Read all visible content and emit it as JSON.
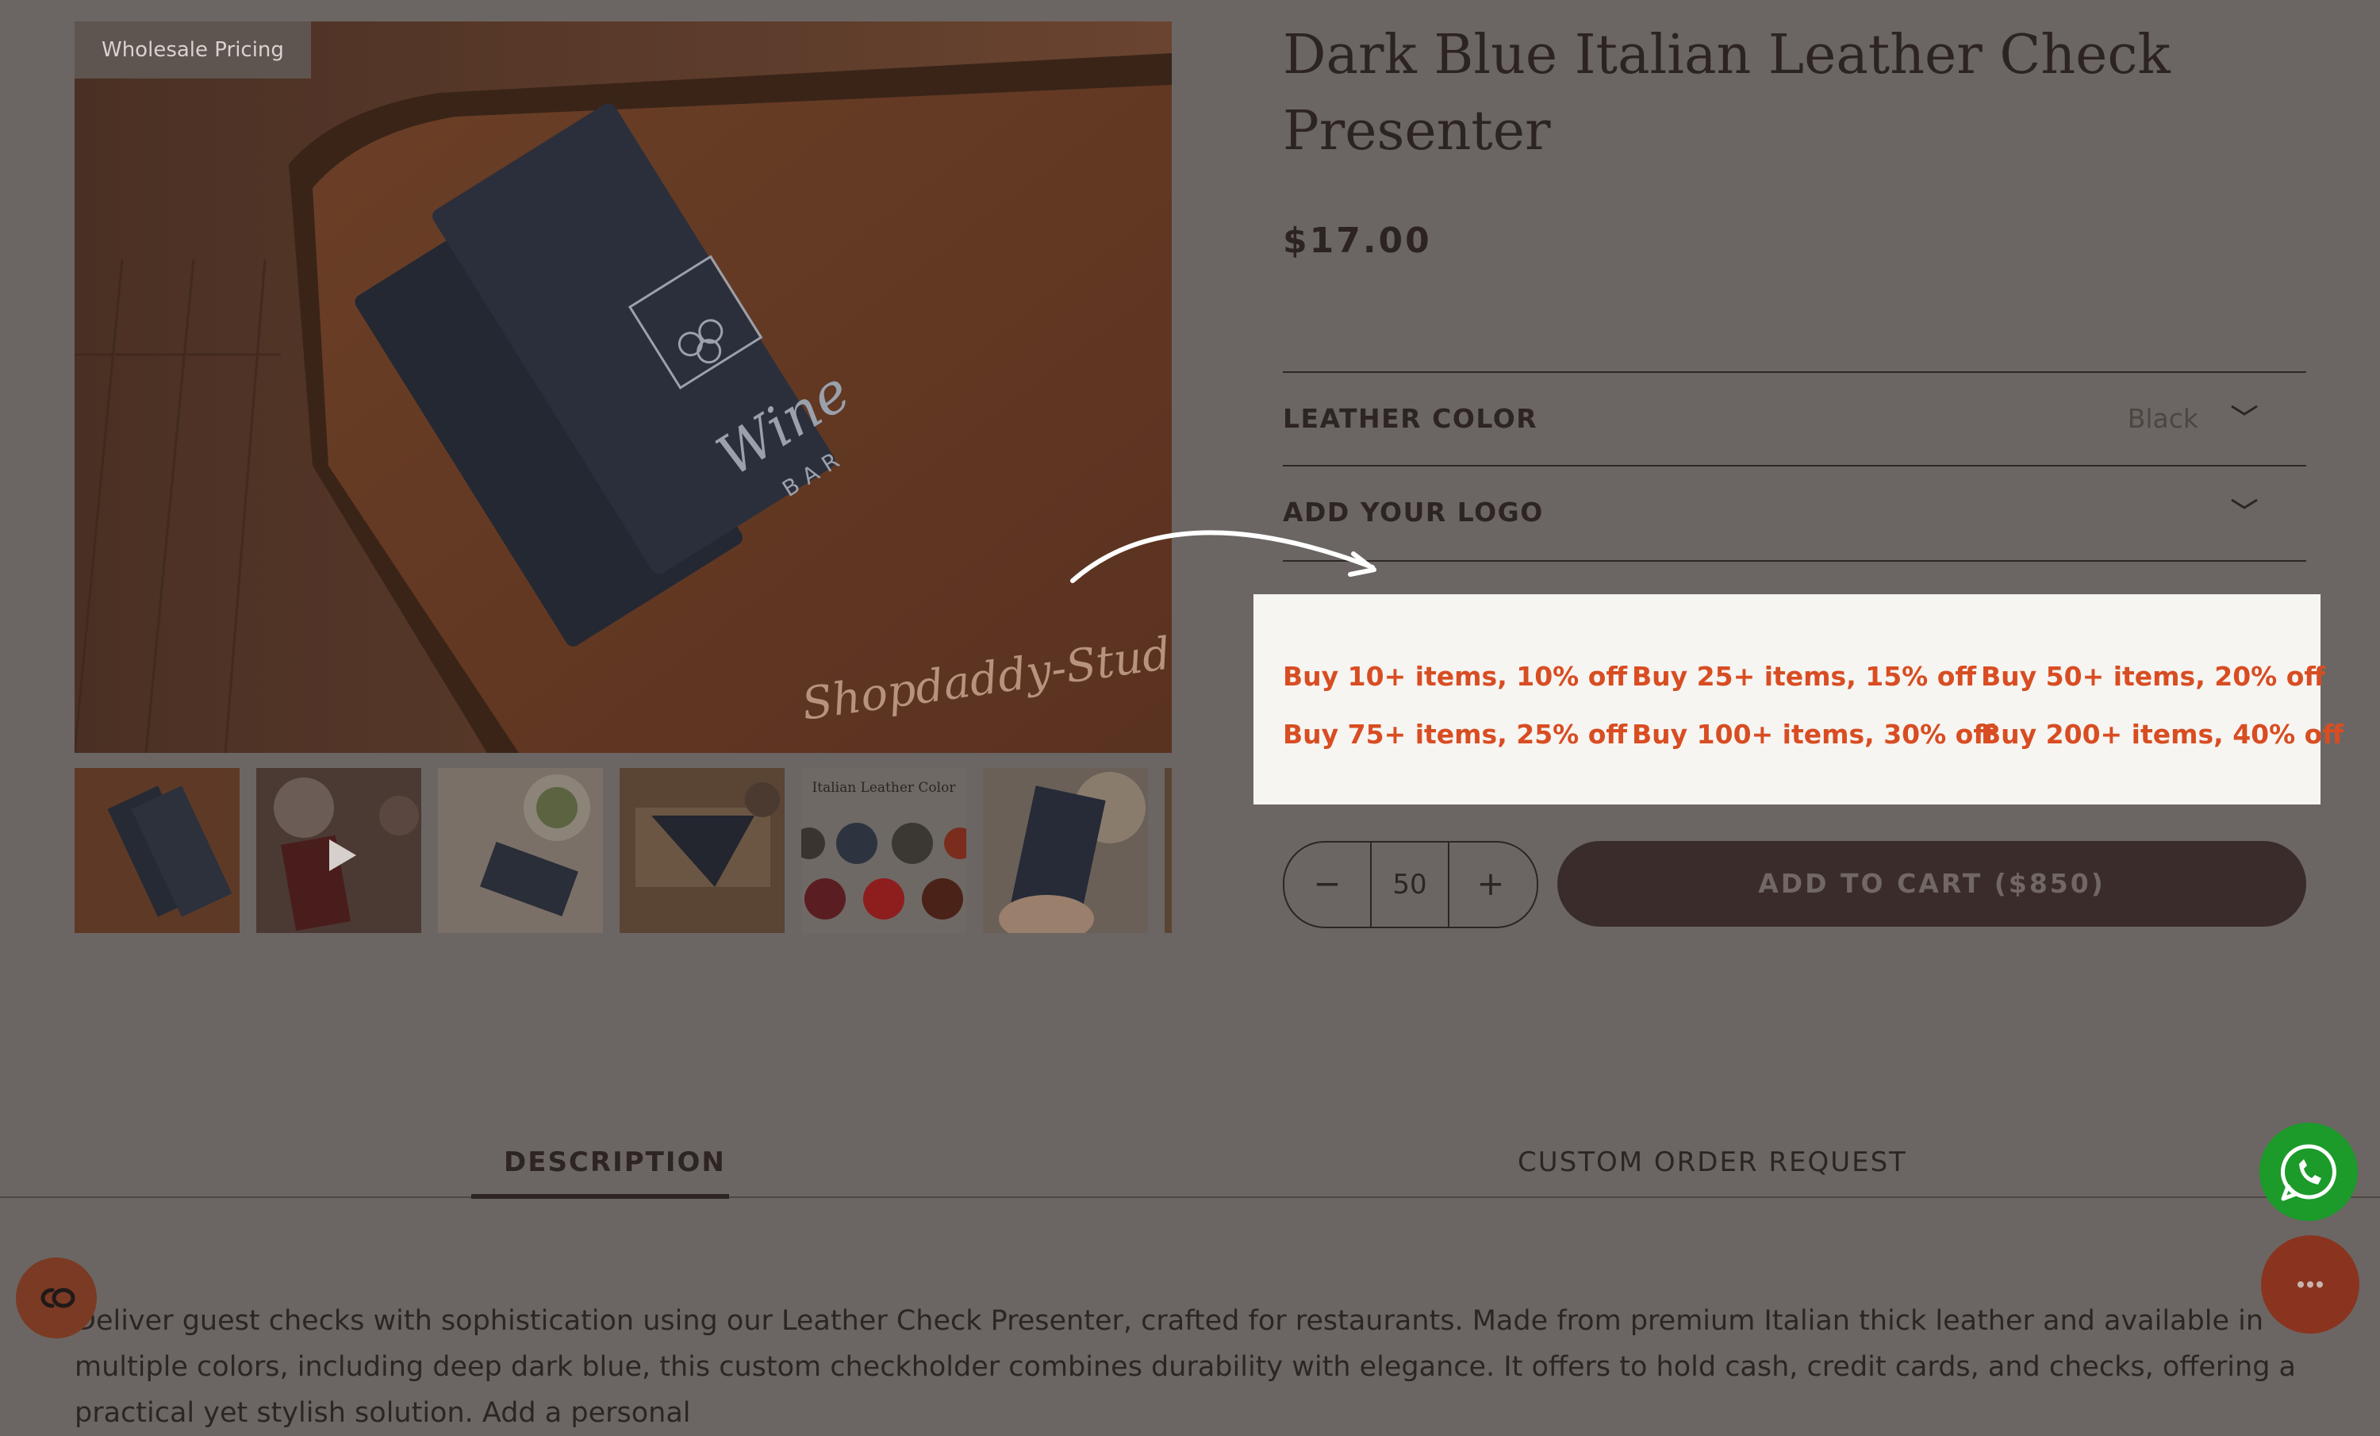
{
  "gallery": {
    "badge": "Wholesale Pricing",
    "main_image_watermark": "Shopdaddy-Studio",
    "main_image_logo_text": "Wine",
    "main_image_logo_sub": "BAR",
    "thumbnails": [
      {
        "alt": "black check presenter on leather"
      },
      {
        "alt": "burgundy check presenter video"
      },
      {
        "alt": "presenter with salad and coffee"
      },
      {
        "alt": "hands opening presenter"
      },
      {
        "alt": "Italian Leather Color swatches",
        "caption": "Italian Leather Color"
      },
      {
        "alt": "hand holding navy presenter"
      },
      {
        "alt": "more images"
      }
    ]
  },
  "product": {
    "title": "Dark Blue Italian Leather Check Presenter",
    "price": "$17.00",
    "options": [
      {
        "label": "LEATHER COLOR",
        "value": "Black"
      },
      {
        "label": "ADD YOUR LOGO",
        "value": ""
      }
    ],
    "discounts": [
      "Buy 10+ items, 10% off",
      "Buy 25+ items, 15% off",
      "Buy 50+ items, 20% off",
      "Buy 75+ items, 25% off",
      "Buy 100+ items, 30% off",
      "Buy 200+ items, 40% off"
    ],
    "quantity": {
      "value": "50",
      "minus": "−",
      "plus": "+"
    },
    "add_to_cart": "ADD TO CART  ($850)"
  },
  "tabs": [
    {
      "label": "DESCRIPTION",
      "active": true
    },
    {
      "label": "CUSTOM ORDER REQUEST",
      "active": false
    }
  ],
  "description": "Deliver guest checks with sophistication using our Leather Check Presenter, crafted for restaurants. Made from premium Italian thick leather and available in multiple colors, including deep dark blue, this custom checkholder combines durability with elegance. It offers to hold cash, credit cards, and checks, offering a practical yet stylish solution. Add a personal",
  "floating": {
    "left_widget_icon": "cookie-consent-icon",
    "whatsapp_icon": "whatsapp-icon",
    "chat_icon": "chat-icon"
  },
  "colors": {
    "discount_text": "#d84d22",
    "whatsapp": "#1c9a2a",
    "chat": "#8a3420",
    "overlay_bg": "#6b6663"
  }
}
